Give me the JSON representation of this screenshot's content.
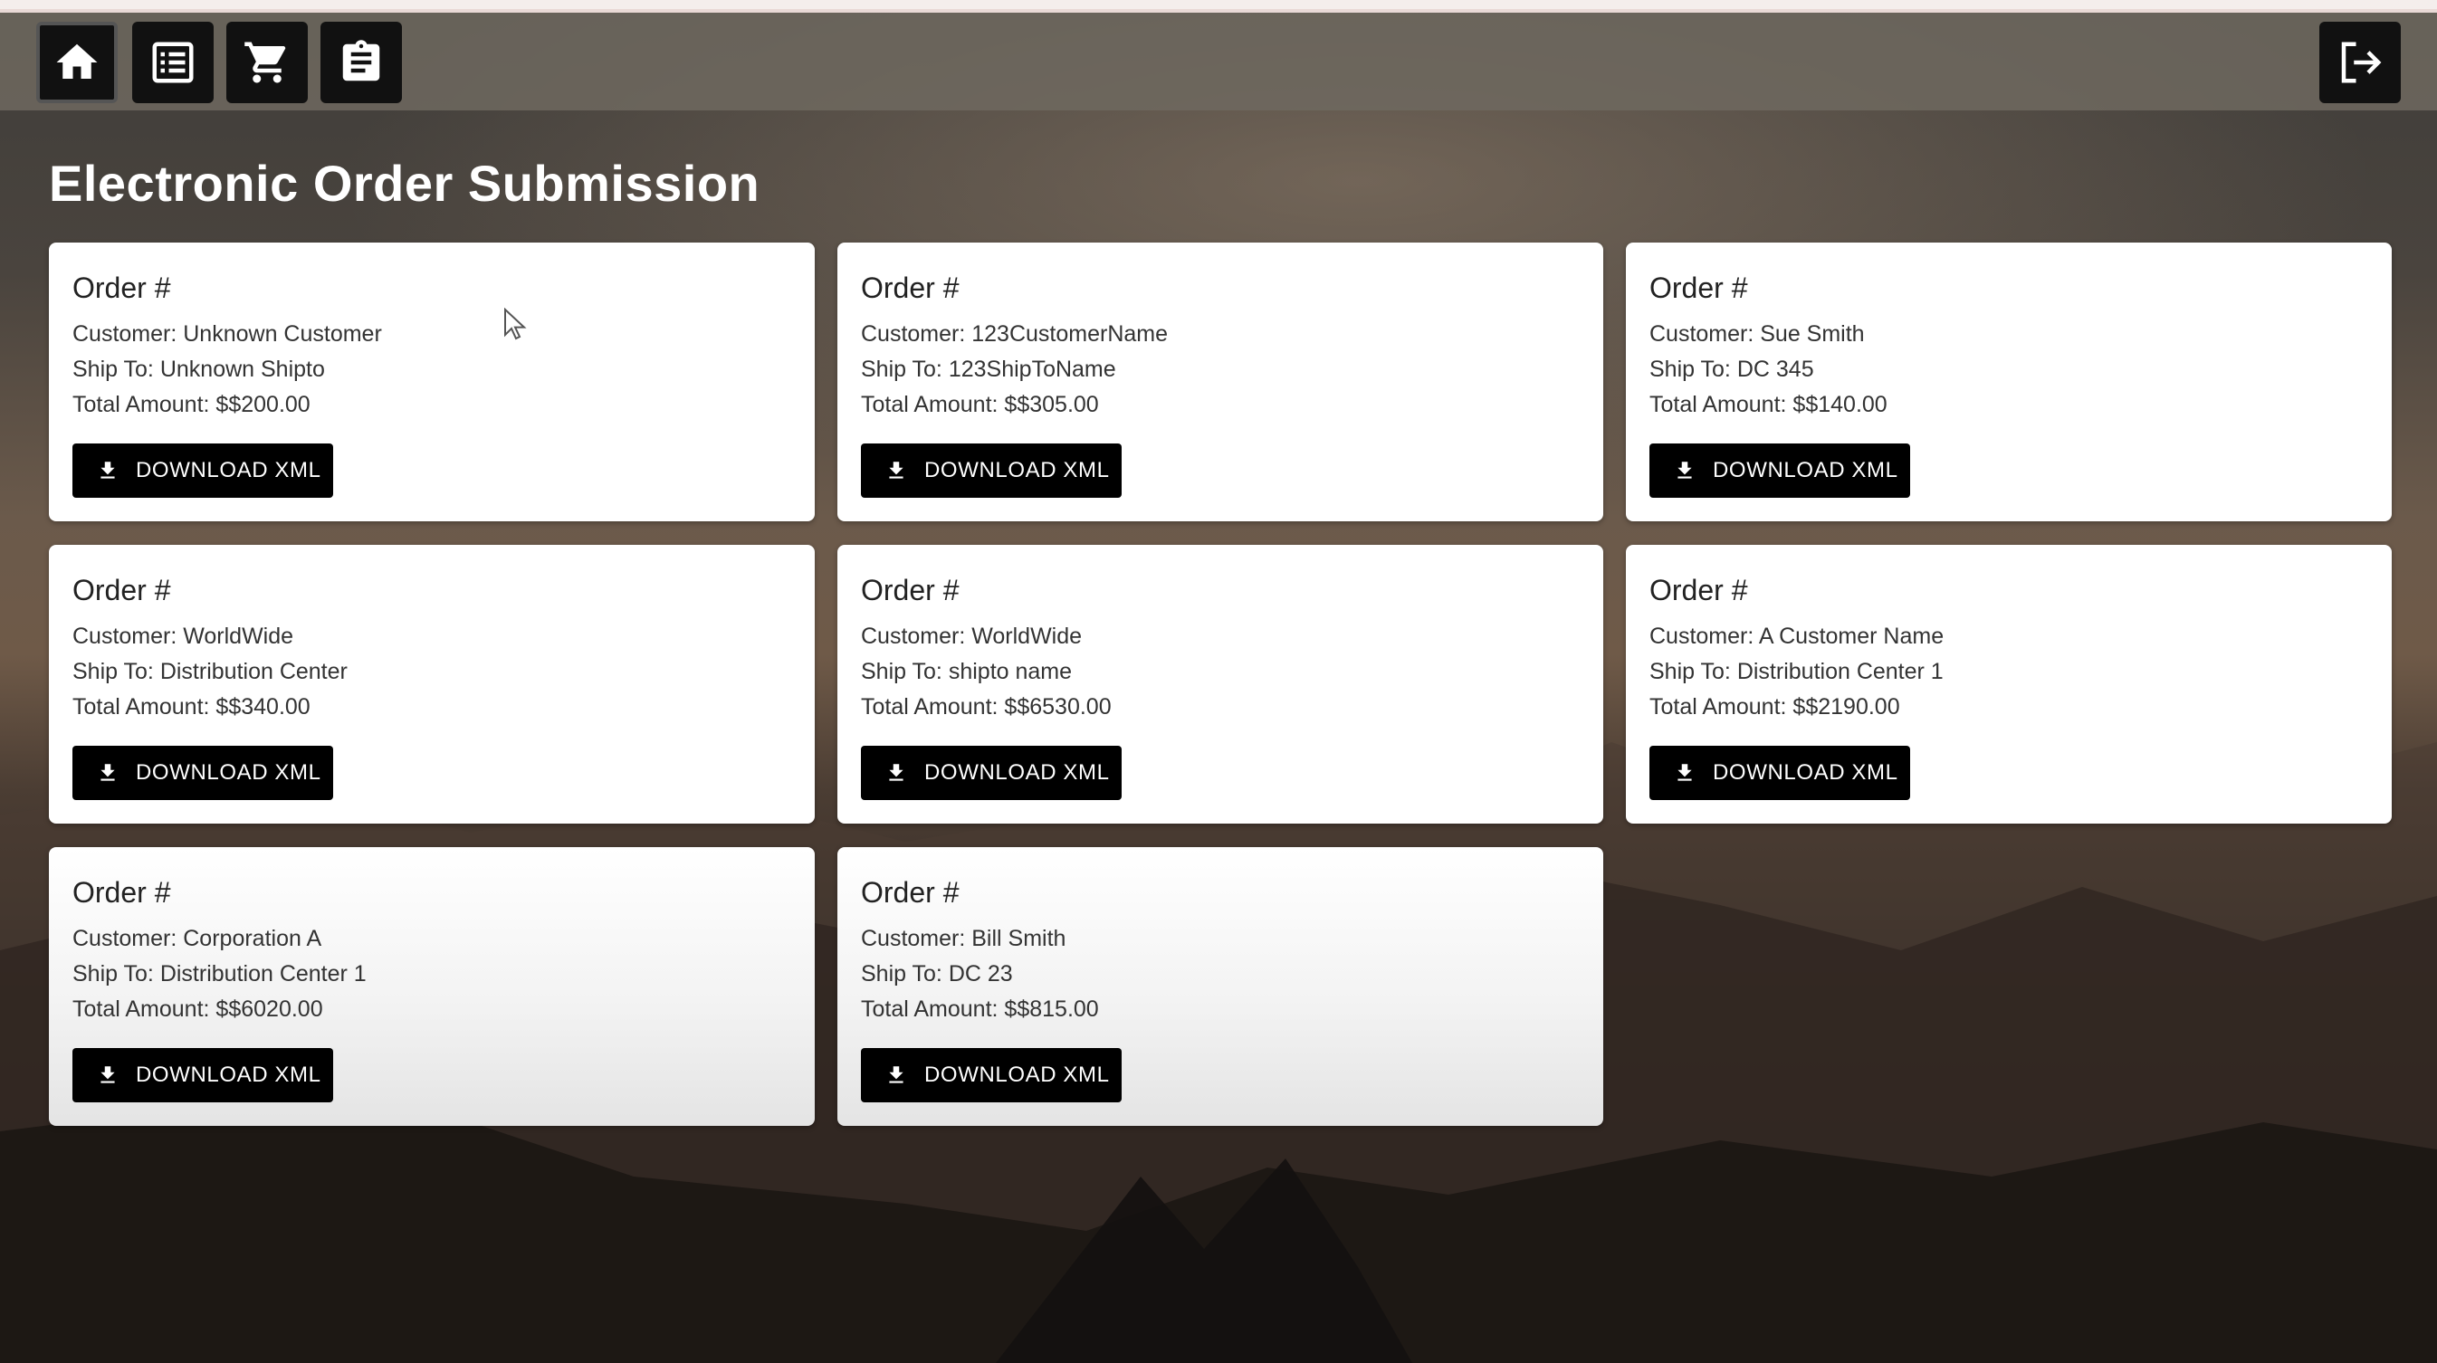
{
  "nav": {
    "home_icon": "home-icon",
    "list_icon": "list-icon",
    "cart_icon": "cart-icon",
    "clipboard_icon": "clipboard-icon",
    "logout_icon": "logout-icon"
  },
  "page": {
    "title": "Electronic Order Submission"
  },
  "colors": {
    "card_bg": "#ffffff",
    "button_bg": "#000000",
    "button_text": "#ffffff",
    "title_text": "#ffffff"
  },
  "orders": [
    {
      "title": "Order #",
      "customer": "Customer: Unknown Customer",
      "ship_to": "Ship To: Unknown Shipto",
      "total": "Total Amount: $$200.00",
      "button": "DOWNLOAD XML"
    },
    {
      "title": "Order #",
      "customer": "Customer: 123CustomerName",
      "ship_to": "Ship To: 123ShipToName",
      "total": "Total Amount: $$305.00",
      "button": "DOWNLOAD XML"
    },
    {
      "title": "Order #",
      "customer": "Customer: Sue Smith",
      "ship_to": "Ship To: DC 345",
      "total": "Total Amount: $$140.00",
      "button": "DOWNLOAD XML"
    },
    {
      "title": "Order #",
      "customer": "Customer: WorldWide",
      "ship_to": "Ship To: Distribution Center",
      "total": "Total Amount: $$340.00",
      "button": "DOWNLOAD XML"
    },
    {
      "title": "Order #",
      "customer": "Customer: WorldWide",
      "ship_to": "Ship To: shipto name",
      "total": "Total Amount: $$6530.00",
      "button": "DOWNLOAD XML"
    },
    {
      "title": "Order #",
      "customer": "Customer: A Customer Name",
      "ship_to": "Ship To: Distribution Center 1",
      "total": "Total Amount: $$2190.00",
      "button": "DOWNLOAD XML"
    },
    {
      "title": "Order #",
      "customer": "Customer: Corporation A",
      "ship_to": "Ship To: Distribution Center 1",
      "total": "Total Amount: $$6020.00",
      "button": "DOWNLOAD XML"
    },
    {
      "title": "Order #",
      "customer": "Customer: Bill Smith",
      "ship_to": "Ship To: DC 23",
      "total": "Total Amount: $$815.00",
      "button": "DOWNLOAD XML"
    }
  ]
}
